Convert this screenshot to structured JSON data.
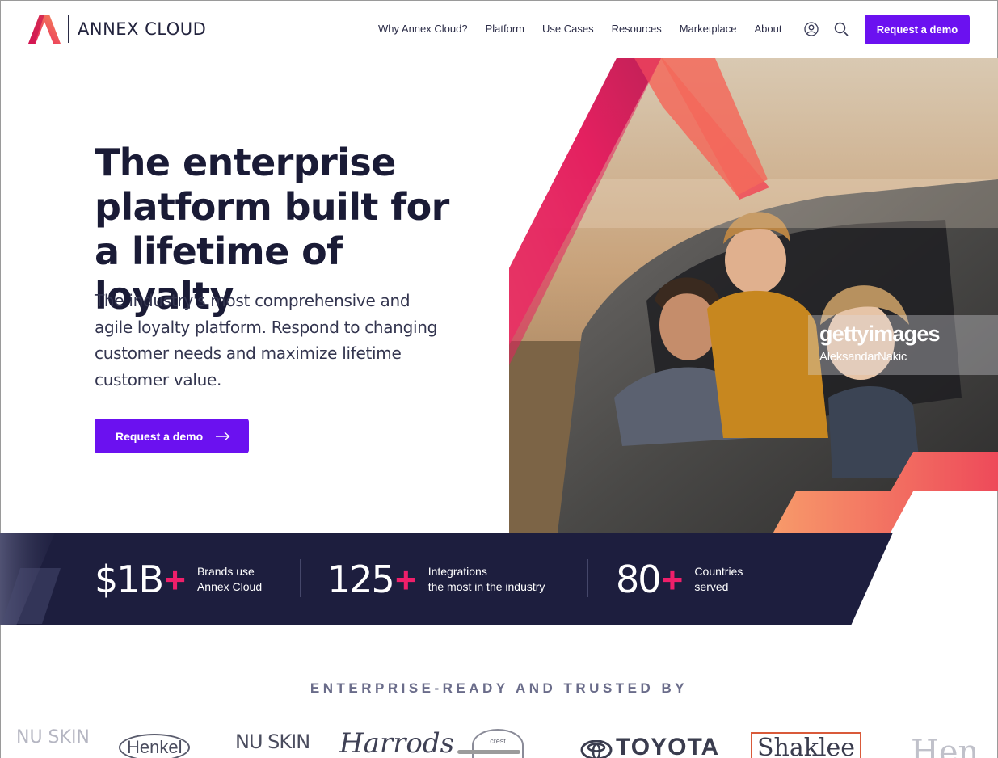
{
  "header": {
    "logo_text": "ANNEX CLOUD",
    "nav": [
      "Why Annex Cloud?",
      "Platform",
      "Use Cases",
      "Resources",
      "Marketplace",
      "About"
    ],
    "cta": "Request a demo",
    "icons": [
      "user-icon",
      "search-icon"
    ]
  },
  "hero": {
    "title": "The enterprise platform built for a lifetime of loyalty",
    "subtitle": "The industry's most comprehensive and agile loyalty platform. Respond to changing customer needs and maximize lifetime customer value.",
    "cta": "Request a demo"
  },
  "watermark": {
    "brand": "gettyimages",
    "author": "AleksandarNakic"
  },
  "stats": [
    {
      "value": "$1B",
      "plus": "+",
      "line1": "Brands use",
      "line2": "Annex Cloud"
    },
    {
      "value": "125",
      "plus": "+",
      "line1": "Integrations",
      "line2": "the most in the industry"
    },
    {
      "value": "80",
      "plus": "+",
      "line1": "Countries",
      "line2": "served"
    }
  ],
  "trusted": {
    "heading": "ENTERPRISE-READY AND TRUSTED BY",
    "brands": [
      "NU SKIN",
      "Henkel",
      "NU SKIN",
      "Harrods",
      "crest",
      "TOYOTA",
      "Shaklee",
      "Hen"
    ]
  },
  "colors": {
    "accent": "#6b11f0",
    "navy": "#1c1d3a",
    "pink": "#ef1f6a",
    "coral": "#f47a55"
  }
}
